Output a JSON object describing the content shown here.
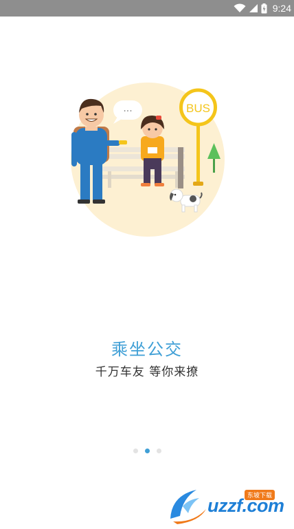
{
  "status_bar": {
    "time": "9:24"
  },
  "illustration": {
    "sign_text": "BUS",
    "bubble_text": "..."
  },
  "onboarding": {
    "headline": "乘坐公交",
    "subline": "千万车友 等你来撩"
  },
  "pager": {
    "count": 3,
    "active_index": 1
  },
  "watermark": {
    "text": "uzzf.com",
    "badge": "东坡下载"
  },
  "colors": {
    "accent": "#3f9fd6",
    "circle_bg": "#fdf0d2",
    "status_bar": "#8e8e8e"
  }
}
